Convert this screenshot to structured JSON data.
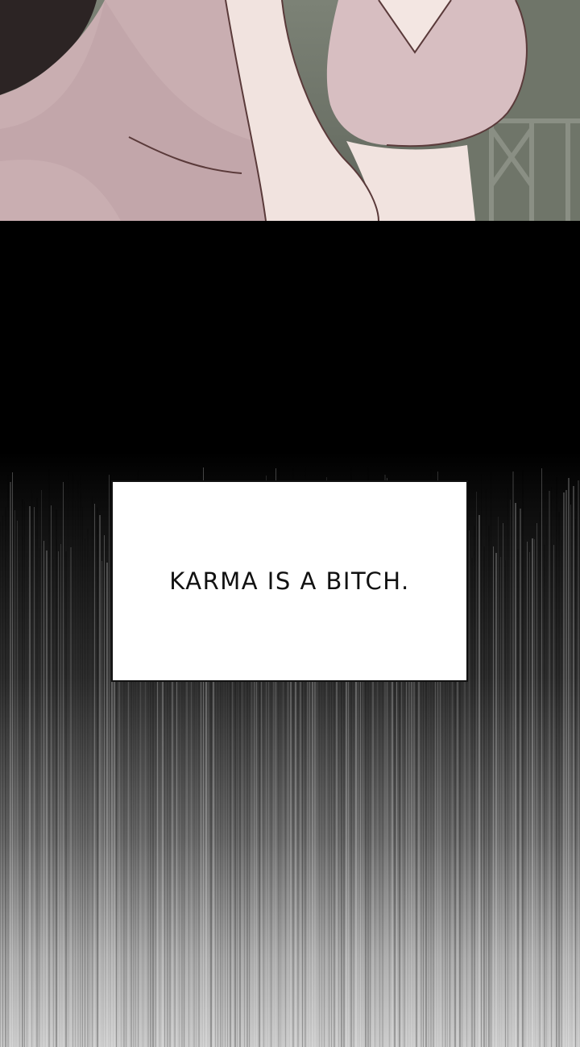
{
  "caption": {
    "text": "KARMA IS A BITCH."
  },
  "colors": {
    "background": "#000000",
    "caption_background": "#ffffff",
    "caption_text": "#111111",
    "skin": "#cbb0b4",
    "top_bg": "#7c8276",
    "gradient_end": "#c9c9c9"
  }
}
